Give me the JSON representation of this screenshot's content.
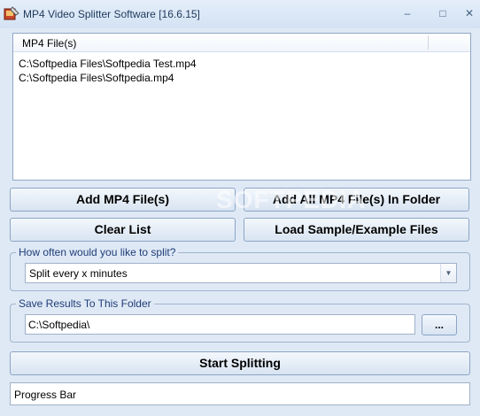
{
  "window": {
    "title": "MP4 Video Splitter Software [16.6.15]",
    "minimize_glyph": "–",
    "maximize_glyph": "□",
    "close_glyph": "✕"
  },
  "file_list": {
    "column_header": "MP4 File(s)",
    "rows": [
      "C:\\Softpedia Files\\Softpedia Test.mp4",
      "C:\\Softpedia Files\\Softpedia.mp4"
    ]
  },
  "buttons": {
    "add_files": "Add MP4 File(s)",
    "add_folder": "Add All MP4 File(s) In Folder",
    "clear_list": "Clear List",
    "load_samples": "Load Sample/Example Files",
    "browse": "...",
    "start": "Start Splitting"
  },
  "split_group": {
    "title": "How often would you like to split?",
    "selected": "Split every x minutes"
  },
  "save_group": {
    "title": "Save Results To This Folder",
    "folder": "C:\\Softpedia\\"
  },
  "progress": {
    "label": "Progress Bar",
    "value": 0
  },
  "watermark": "SOFTPEDIA",
  "colors": {
    "accent": "#1f3c78",
    "background": "#dfe9f5",
    "border": "#8da5c5"
  },
  "icons": [
    "app-icon",
    "minimize-icon",
    "maximize-icon",
    "close-icon",
    "chevron-down-icon"
  ]
}
